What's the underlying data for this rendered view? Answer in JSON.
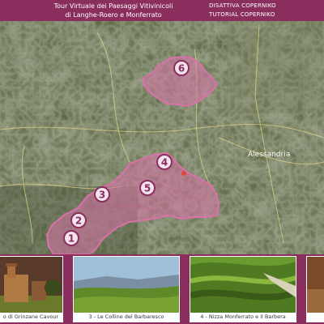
{
  "header": {
    "title_line1": "Tour Virtuale dei Paesaggi Vitivinicoli",
    "title_line2": "di Langhe-Roero e Monferrato",
    "menu": [
      "DISATTIVA COPERNIKO",
      "TUTORIAL COPERNIKO"
    ]
  },
  "map": {
    "town_label": "Alessandria",
    "markers": [
      "1",
      "2",
      "3",
      "4",
      "5",
      "6"
    ]
  },
  "thumbnails": [
    {
      "caption": "o di Grinzane Cavour"
    },
    {
      "caption": "3 - Le Colline del Barbaresco"
    },
    {
      "caption": "4 - Nizza Monferrato e il Barbera"
    },
    {
      "caption": ""
    }
  ],
  "colors": {
    "brand": "#8a2e5e",
    "region_fill": "#d872a8"
  }
}
